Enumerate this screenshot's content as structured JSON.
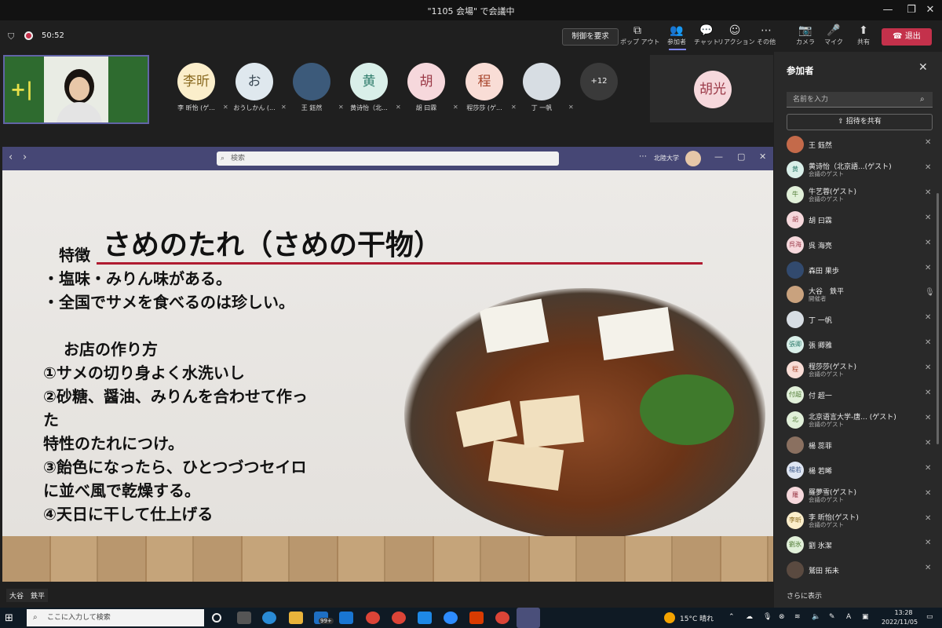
{
  "window": {
    "title": "\"1105 会場\" で会議中",
    "minimize": "—",
    "maximize": "❐",
    "close": "✕"
  },
  "toolbar": {
    "timer": "50:52",
    "control_label": "制御を要求",
    "items": [
      {
        "icon": "popout-icon",
        "glyph": "⧉",
        "label": "ポップ アウト"
      },
      {
        "icon": "people-icon",
        "glyph": "👥",
        "label": "参加者"
      },
      {
        "icon": "chat-icon",
        "glyph": "💬",
        "label": "チャット"
      },
      {
        "icon": "reaction-icon",
        "glyph": "☺",
        "label": "リアクション"
      },
      {
        "icon": "more-icon",
        "glyph": "⋯",
        "label": "その他"
      },
      {
        "icon": "camera-off-icon",
        "glyph": "📷",
        "label": "カメラ"
      },
      {
        "icon": "mic-off-icon",
        "glyph": "🎤",
        "label": "マイク"
      },
      {
        "icon": "share-icon",
        "glyph": "⬆",
        "label": "共有"
      }
    ],
    "leave_label": "退出"
  },
  "gallery": {
    "avatars": [
      {
        "initials": "李昕",
        "name": "李 昕怡 (ゲ...",
        "bg": "#fbeecb",
        "fg": "#8a6a20"
      },
      {
        "initials": "お",
        "name": "おうしかん (...",
        "bg": "#dfe8ee",
        "fg": "#3b4a55"
      },
      {
        "initials": "",
        "name": "王 鈺然",
        "bg": "#3c5a7a",
        "fg": "#fff"
      },
      {
        "initials": "黄",
        "name": "黄诗怡（北...",
        "bg": "#d9efe9",
        "fg": "#2f7c6c"
      },
      {
        "initials": "胡",
        "name": "胡 曰霖",
        "bg": "#f6d8dc",
        "fg": "#9b3a48"
      },
      {
        "initials": "程",
        "name": "程莎莎 (ゲ...",
        "bg": "#f9ddd6",
        "fg": "#a8452c"
      },
      {
        "initials": "",
        "name": "丁 一帆",
        "bg": "#d7dde3",
        "fg": "#333"
      },
      {
        "initials": "+12",
        "name": "",
        "bg": "#3a3a3a",
        "fg": "#eee"
      }
    ],
    "large_tile": {
      "initials": "胡光",
      "bg": "#f6d8dc",
      "fg": "#9b3a48"
    }
  },
  "share": {
    "search_placeholder": "検索",
    "org": "北陸大学",
    "nav_back": "‹",
    "nav_fwd": "›",
    "more": "⋯"
  },
  "slide": {
    "title": "さめのたれ（さめの干物）",
    "lines": [
      "特徴",
      "・塩味・みりん味がある。",
      "・全国でサメを食べるのは珍しい。",
      "お店の作り方",
      "①サメの切り身よく水洗いし",
      "②砂糖、醤油、みりんを合わせて作っ",
      "た",
      "特性のたれにつけ。",
      "③飴色になったら、ひとつづつセイロ",
      "に並べ風で乾燥する。",
      "④天日に干して仕上げる"
    ]
  },
  "speaker_label": "大谷　鉄平",
  "panel": {
    "title": "参加者",
    "search_placeholder": "名前を入力",
    "invite_label": "招待を共有",
    "more_label": "さらに表示",
    "participants": [
      {
        "initials": "",
        "name": "王 鈺然",
        "sub": "",
        "bg": "#c46a4a",
        "fg": "#fff"
      },
      {
        "initials": "黄",
        "name": "黄诗怡（北京語...(ゲスト)",
        "sub": "会議のゲスト",
        "bg": "#d9efe9",
        "fg": "#2f7c6c"
      },
      {
        "initials": "牛",
        "name": "牛艺蓉(ゲスト)",
        "sub": "会議のゲスト",
        "bg": "#e1f0d9",
        "fg": "#4f7a34"
      },
      {
        "initials": "胡",
        "name": "胡 曰霖",
        "sub": "",
        "bg": "#f6d8dc",
        "fg": "#9b3a48"
      },
      {
        "initials": "呉海",
        "name": "呉 海亮",
        "sub": "",
        "bg": "#f6d8dc",
        "fg": "#9b3a48"
      },
      {
        "initials": "",
        "name": "森田 果歩",
        "sub": "",
        "bg": "#324a6e",
        "fg": "#fff"
      },
      {
        "initials": "",
        "name": "大谷　鉄平",
        "sub": "開催者",
        "bg": "#c9a27e",
        "fg": "#fff"
      },
      {
        "initials": "",
        "name": "丁 一帆",
        "sub": "",
        "bg": "#d7dde3",
        "fg": "#333"
      },
      {
        "initials": "張卿",
        "name": "張 卿雅",
        "sub": "",
        "bg": "#d9efe9",
        "fg": "#2f7c6c"
      },
      {
        "initials": "程",
        "name": "程莎莎(ゲスト)",
        "sub": "会議のゲスト",
        "bg": "#f9ddd6",
        "fg": "#a8452c"
      },
      {
        "initials": "付超",
        "name": "付 超一",
        "sub": "",
        "bg": "#e1f0d9",
        "fg": "#4f7a34"
      },
      {
        "initials": "北",
        "name": "北京语言大学-唐... (ゲスト)",
        "sub": "会議のゲスト",
        "bg": "#e1f0d9",
        "fg": "#4f7a34"
      },
      {
        "initials": "",
        "name": "楊 蕊菲",
        "sub": "",
        "bg": "#8a7060",
        "fg": "#fff"
      },
      {
        "initials": "楊若",
        "name": "楊 若晞",
        "sub": "",
        "bg": "#dfe6f3",
        "fg": "#3f5a8a"
      },
      {
        "initials": "羅",
        "name": "羅夢雪(ゲスト)",
        "sub": "会議のゲスト",
        "bg": "#f6d8dc",
        "fg": "#9b3a48"
      },
      {
        "initials": "李昕",
        "name": "李 昕怡(ゲスト)",
        "sub": "会議のゲスト",
        "bg": "#fbeecb",
        "fg": "#8a6a20"
      },
      {
        "initials": "劉氷",
        "name": "劉 氷潔",
        "sub": "",
        "bg": "#e1f0d9",
        "fg": "#4f7a34"
      },
      {
        "initials": "",
        "name": "鷲田 拓未",
        "sub": "",
        "bg": "#5a4a40",
        "fg": "#fff"
      }
    ]
  },
  "taskbar": {
    "search_placeholder": "ここに入力して検索",
    "weather": "15°C 晴れ",
    "time": "13:28",
    "date": "2022/11/05",
    "badge": "99+"
  }
}
